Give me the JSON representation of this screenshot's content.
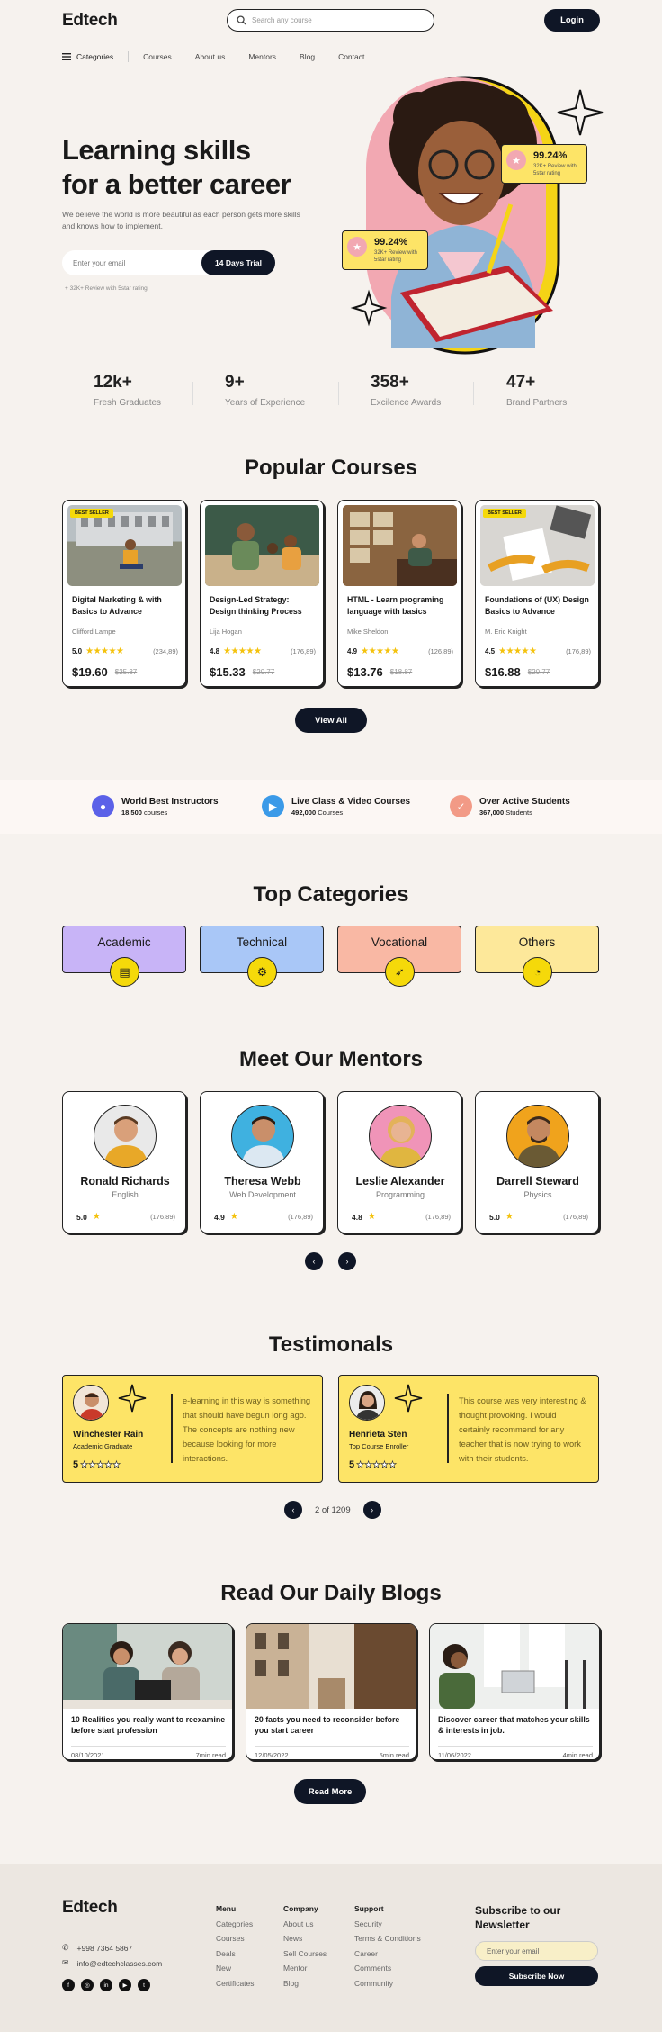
{
  "header": {
    "logo": "Edtech",
    "search_placeholder": "Search any course",
    "login": "Login"
  },
  "nav": {
    "categories": "Categories",
    "links": [
      "Courses",
      "About us",
      "Mentors",
      "Blog",
      "Contact"
    ]
  },
  "hero": {
    "title_line1": "Learning skills",
    "title_line2": "for a better career",
    "subtitle": "We believe the world is more beautiful as each person gets more skills and knows how to implement.",
    "email_placeholder": "Enter your email",
    "cta": "14 Days Trial",
    "review_note": "+ 32K+ Review with 5star rating",
    "badge1": {
      "value": "99.24%",
      "text": "32K+ Review with 5star rating"
    },
    "badge2": {
      "value": "99.24%",
      "text": "32K+ Review with 5star rating"
    }
  },
  "stats": [
    {
      "value": "12k+",
      "label": "Fresh Graduates"
    },
    {
      "value": "9+",
      "label": "Years of Experience"
    },
    {
      "value": "358+",
      "label": "Excilence Awards"
    },
    {
      "value": "47+",
      "label": "Brand Partners"
    }
  ],
  "courses_section": {
    "title": "Popular Courses",
    "view_all": "View All"
  },
  "courses": [
    {
      "badge": "BEST SELLER",
      "title": "Digital Marketing & with Basics to Advance",
      "author": "Clifford Lampe",
      "rating": "5.0",
      "stars": "★★★★★",
      "count": "(234,89)",
      "price": "$19.60",
      "old_price": "$25.37"
    },
    {
      "badge": "",
      "title": "Design-Led Strategy: Design thinking Process",
      "author": "Lija Hogan",
      "rating": "4.8",
      "stars": "★★★★★",
      "count": "(176,89)",
      "price": "$15.33",
      "old_price": "$20.77"
    },
    {
      "badge": "",
      "title": "HTML - Learn programing language with basics",
      "author": "Mike Sheldon",
      "rating": "4.9",
      "stars": "★★★★★",
      "count": "(126,89)",
      "price": "$13.76",
      "old_price": "$18.87"
    },
    {
      "badge": "BEST SELLER",
      "title": "Foundations of (UX) Design Basics to Advance",
      "author": "M. Eric Knight",
      "rating": "4.5",
      "stars": "★★★★★",
      "count": "(176,89)",
      "price": "$16.88",
      "old_price": "$20.77"
    }
  ],
  "features": [
    {
      "title": "World Best Instructors",
      "num": "18,500",
      "unit": "courses",
      "color": "#5b61e8"
    },
    {
      "title": "Live Class & Video Courses",
      "num": "492,000",
      "unit": "Courses",
      "color": "#3b9ae8"
    },
    {
      "title": "Over Active Students",
      "num": "367,000",
      "unit": "Students",
      "color": "#f29a86"
    }
  ],
  "categories_section": {
    "title": "Top Categories"
  },
  "categories": [
    {
      "label": "Academic",
      "color": "#c8b4f7"
    },
    {
      "label": "Technical",
      "color": "#a9c7f7"
    },
    {
      "label": "Vocational",
      "color": "#f9b8a4"
    },
    {
      "label": "Others",
      "color": "#fde89a"
    }
  ],
  "mentors_section": {
    "title": "Meet Our Mentors",
    "prev": "‹",
    "next": "›"
  },
  "mentors": [
    {
      "name": "Ronald Richards",
      "role": "English",
      "rating": "5.0",
      "count": "(176,89)",
      "bg": "#e9e9e9",
      "shirt": "#e8a828",
      "skin": "#d9a07a",
      "hair": "#5a3a22"
    },
    {
      "name": "Theresa Webb",
      "role": "Web Development",
      "rating": "4.9",
      "count": "(176,89)",
      "bg": "#3fb1e0",
      "shirt": "#dce8f2",
      "skin": "#c98f6a",
      "hair": "#2a1d15"
    },
    {
      "name": "Leslie Alexander",
      "role": "Programming",
      "rating": "4.8",
      "count": "(176,89)",
      "bg": "#f094b8",
      "shirt": "#e0b640",
      "skin": "#e8b493",
      "hair": "#e3b25a"
    },
    {
      "name": "Darrell Steward",
      "role": "Physics",
      "rating": "5.0",
      "count": "(176,89)",
      "bg": "#f0a31c",
      "shirt": "#6a5a34",
      "skin": "#c48860",
      "hair": "#3c2a1c"
    }
  ],
  "testimonials_section": {
    "title": "Testimonals",
    "pager": "2 of 1209"
  },
  "testimonials": [
    {
      "name": "Winchester Rain",
      "role": "Academic Graduate",
      "rating": "5",
      "stars": "★★★★★",
      "text": "e-learning in this way is something that should have begun long ago. The concepts are nothing new because looking for more interactions."
    },
    {
      "name": "Henrieta Sten",
      "role": "Top Course Enroller",
      "rating": "5",
      "stars": "★★★★★",
      "text": "This course was very interesting & thought provoking. I would certainly recommend for any teacher that is now trying to work with their students."
    }
  ],
  "blogs_section": {
    "title": "Read Our Daily Blogs",
    "read_more": "Read More"
  },
  "blogs": [
    {
      "title": "10 Realities you really want to reexamine before start profession",
      "date": "08/10/2021",
      "read": "7min read"
    },
    {
      "title": "20 facts you need to reconsider before you start career",
      "date": "12/05/2022",
      "read": "5min read"
    },
    {
      "title": "Discover career that matches your skills & interests in job.",
      "date": "11/06/2022",
      "read": "4min read"
    }
  ],
  "footer": {
    "logo": "Edtech",
    "phone": "+998 7364 5867",
    "email": "info@edtechclasses.com",
    "menu": {
      "title": "Menu",
      "items": [
        "Categories",
        "Courses",
        "Deals",
        "New",
        "Certificates"
      ]
    },
    "company": {
      "title": "Company",
      "items": [
        "About us",
        "News",
        "Sell Courses",
        "Mentor",
        "Blog"
      ]
    },
    "support": {
      "title": "Support",
      "items": [
        "Security",
        "Terms & Conditions",
        "Career",
        "Comments",
        "Community"
      ]
    },
    "newsletter": {
      "title": "Subscribe to our Newsletter",
      "placeholder": "Enter your email",
      "button": "Subscribe Now"
    },
    "social": [
      "f",
      "◎",
      "in",
      "▶",
      "t"
    ]
  }
}
